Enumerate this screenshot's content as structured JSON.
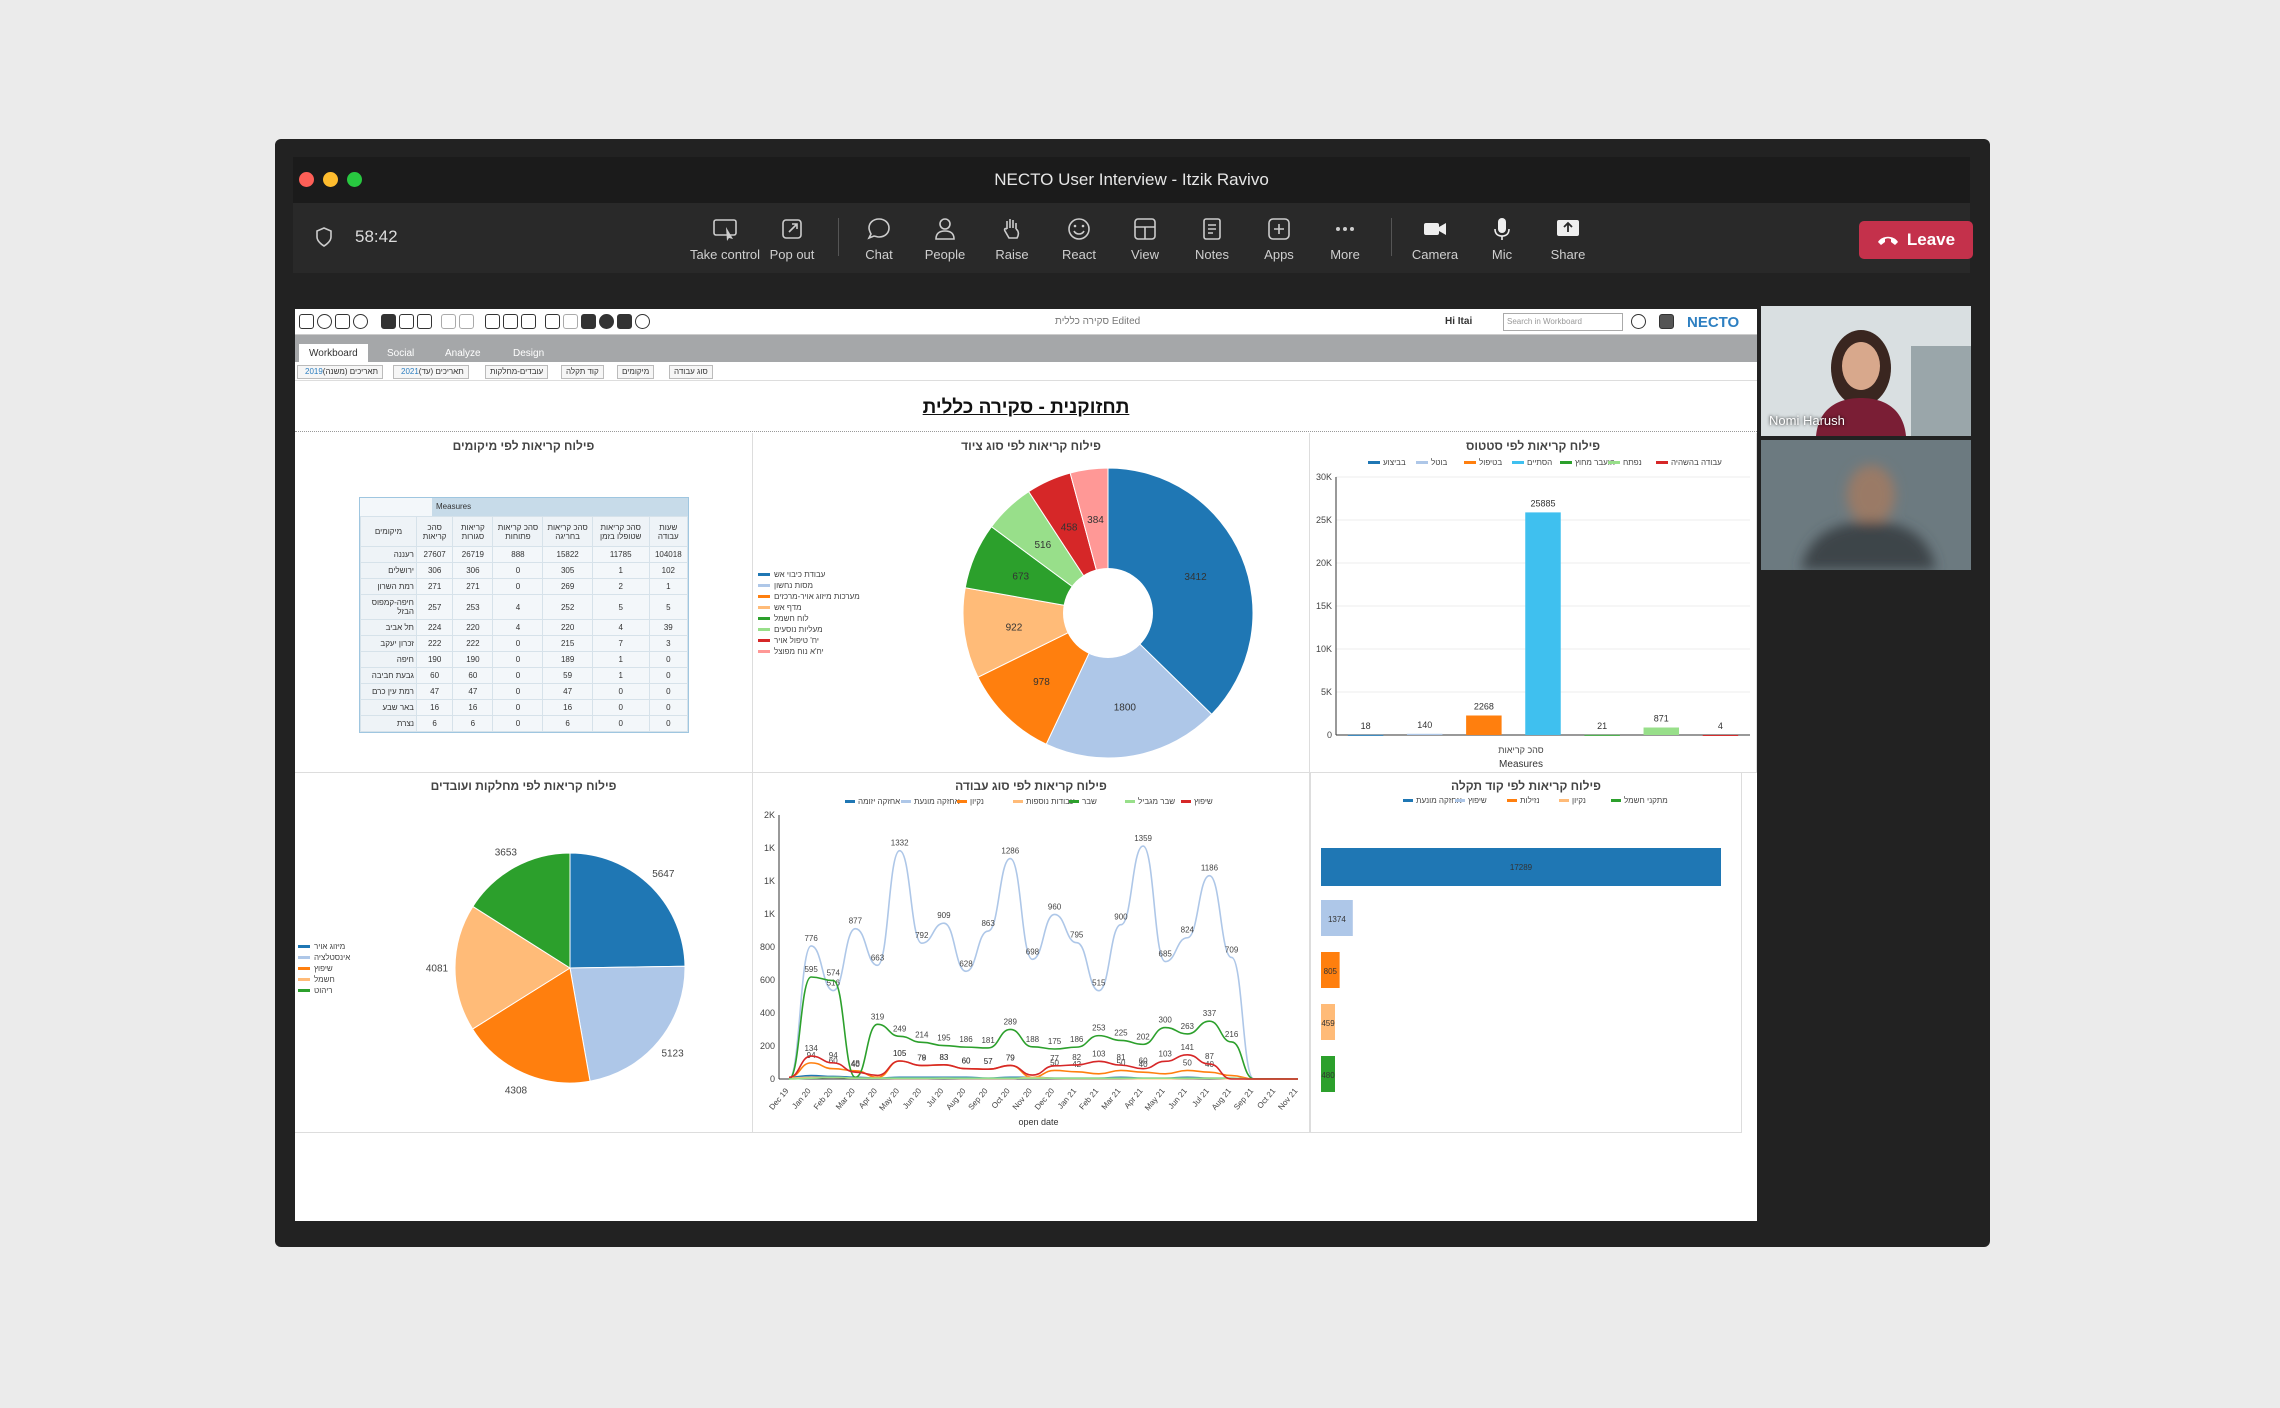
{
  "window": {
    "title": "NECTO User Interview - Itzik Ravivo",
    "timer": "58:42"
  },
  "toolbar": {
    "items": [
      {
        "label": "Take control",
        "icon": "take-control-icon"
      },
      {
        "label": "Pop out",
        "icon": "pop-out-icon"
      },
      {
        "label": "Chat",
        "icon": "chat-icon"
      },
      {
        "label": "People",
        "icon": "people-icon"
      },
      {
        "label": "Raise",
        "icon": "raise-hand-icon"
      },
      {
        "label": "React",
        "icon": "react-icon"
      },
      {
        "label": "View",
        "icon": "view-icon"
      },
      {
        "label": "Notes",
        "icon": "notes-icon"
      },
      {
        "label": "Apps",
        "icon": "apps-icon"
      },
      {
        "label": "More",
        "icon": "more-icon"
      },
      {
        "label": "Camera",
        "icon": "camera-icon"
      },
      {
        "label": "Mic",
        "icon": "mic-icon"
      },
      {
        "label": "Share",
        "icon": "share-icon"
      }
    ],
    "leave": "Leave"
  },
  "participants": [
    {
      "name": "Nomi Harush"
    },
    {
      "name": ""
    }
  ],
  "app": {
    "doc_title": "סקירה כללית Edited",
    "greeting": "Hi Itai",
    "search_placeholder": "Search in Workboard",
    "logo": "NECTO",
    "tabs": [
      "Workboard",
      "Social",
      "Analyze",
      "Design"
    ],
    "filters": [
      {
        "label": "תאריכים (משנה)",
        "value": "2019"
      },
      {
        "label": "תאריכים (עד)",
        "value": "2021"
      },
      {
        "label": "עובדים-מחלקות",
        "value": ""
      },
      {
        "label": "קוד תקלה",
        "value": ""
      },
      {
        "label": "מיקומים",
        "value": ""
      },
      {
        "label": "סוג עבודה",
        "value": ""
      }
    ],
    "dashboard_title": "תחזוקנית - סקירה כללית",
    "colors": {
      "blue": "#1f77b4",
      "lightblue": "#aec7e8",
      "orange": "#ff7f0e",
      "peach": "#ffbb78",
      "green": "#2ca02c",
      "lightgreen": "#98df8a",
      "red": "#d62728",
      "pink": "#ff9896",
      "cyan": "#3fc0ef"
    }
  },
  "location_table": {
    "title": "פילוח קריאות לפי מיקומים",
    "measures_label": "Measures",
    "row_header": "מיקומים",
    "columns": [
      "סהכ קריאות",
      "קריאות סגורות",
      "סהכ קריאות פתוחות",
      "סהכ קריאות בחריגה",
      "סהכ קריאות שטופלו בזמן",
      "שעות עבודה"
    ],
    "rows": [
      {
        "name": "רעננה",
        "values": [
          "27607",
          "26719",
          "888",
          "15822",
          "11785",
          "104018"
        ]
      },
      {
        "name": "ירושלים",
        "values": [
          "306",
          "306",
          "0",
          "305",
          "1",
          "102"
        ]
      },
      {
        "name": "רמת השרון",
        "values": [
          "271",
          "271",
          "0",
          "269",
          "2",
          "1"
        ]
      },
      {
        "name": "חיפה-קמפוס הבזל",
        "values": [
          "257",
          "253",
          "4",
          "252",
          "5",
          "5"
        ]
      },
      {
        "name": "תל אביב",
        "values": [
          "224",
          "220",
          "4",
          "220",
          "4",
          "39"
        ]
      },
      {
        "name": "זכרון יעקב",
        "values": [
          "222",
          "222",
          "0",
          "215",
          "7",
          "3"
        ]
      },
      {
        "name": "חיפה",
        "values": [
          "190",
          "190",
          "0",
          "189",
          "1",
          "0"
        ]
      },
      {
        "name": "גבעת חביבה",
        "values": [
          "60",
          "60",
          "0",
          "59",
          "1",
          "0"
        ]
      },
      {
        "name": "רמת עין כרם",
        "values": [
          "47",
          "47",
          "0",
          "47",
          "0",
          "0"
        ]
      },
      {
        "name": "באר שבע",
        "values": [
          "16",
          "16",
          "0",
          "16",
          "0",
          "0"
        ]
      },
      {
        "name": "נצרת",
        "values": [
          "6",
          "6",
          "0",
          "6",
          "0",
          "0"
        ]
      }
    ]
  },
  "chart_data": [
    {
      "type": "pie",
      "title": "פילוח קריאות לפי סוג ציוד",
      "donut": true,
      "legend_position": "left",
      "slices": [
        {
          "name": "עבודת כיבוי אש",
          "value": 3412,
          "color": "#1f77b4"
        },
        {
          "name": "מסות נחשון",
          "value": 1800,
          "color": "#aec7e8"
        },
        {
          "name": "מערכות מיזוג אויר-מרכזים",
          "value": 978,
          "color": "#ff7f0e"
        },
        {
          "name": "מדף אש",
          "value": 922,
          "color": "#ffbb78"
        },
        {
          "name": "לוח חשמל",
          "value": 673,
          "color": "#2ca02c"
        },
        {
          "name": "מעליות נוסעים",
          "value": 516,
          "color": "#98df8a"
        },
        {
          "name": "יח' טיפול אויר",
          "value": 458,
          "color": "#d62728"
        },
        {
          "name": "יח'א נוח מפוצל",
          "value": 384,
          "color": "#ff9896"
        }
      ]
    },
    {
      "type": "bar",
      "title": "פילוח קריאות לפי סטטוס",
      "xlabel": "Measures",
      "category_label": "סהכ קריאות",
      "ylim": [
        0,
        30000
      ],
      "yticks": [
        "0",
        "5K",
        "10K",
        "15K",
        "20K",
        "25K",
        "30K"
      ],
      "legend_position": "top",
      "series": [
        {
          "name": "בביצוע",
          "value": 18,
          "color": "#1f77b4"
        },
        {
          "name": "בוטל",
          "value": 140,
          "color": "#aec7e8"
        },
        {
          "name": "בטיפול",
          "value": 2268,
          "color": "#ff7f0e"
        },
        {
          "name": "הסתיים",
          "value": 25885,
          "color": "#3fc0ef"
        },
        {
          "name": "הועבר מחוץ",
          "value": 21,
          "color": "#2ca02c"
        },
        {
          "name": "נפתח",
          "value": 871,
          "color": "#98df8a"
        },
        {
          "name": "עבודה בהשהיה",
          "value": 4,
          "color": "#d62728"
        }
      ]
    },
    {
      "type": "pie",
      "title": "פילוח קריאות לפי מחלקות ועובדים",
      "legend_position": "left",
      "slices": [
        {
          "name": "מיזוג אויר",
          "value": 5647,
          "color": "#1f77b4"
        },
        {
          "name": "אינסטלציה",
          "value": 5123,
          "color": "#aec7e8"
        },
        {
          "name": "שיפוץ",
          "value": 4308,
          "color": "#ff7f0e"
        },
        {
          "name": "חשמל",
          "value": 4081,
          "color": "#ffbb78"
        },
        {
          "name": "ריהוט",
          "value": 3653,
          "color": "#2ca02c"
        }
      ]
    },
    {
      "type": "line",
      "title": "פילוח קריאות לפי סוג עבודה",
      "xlabel": "open date",
      "ylim": [
        0,
        1400
      ],
      "yticks": [
        "0",
        "200",
        "400",
        "600",
        "800",
        "1K",
        "1K",
        "1K",
        "2K"
      ],
      "x": [
        "Dec 19",
        "Jan 20",
        "Feb 20",
        "Mar 20",
        "Apr 20",
        "May 20",
        "Jun 20",
        "Jul 20",
        "Aug 20",
        "Sep 20",
        "Oct 20",
        "Nov 20",
        "Dec 20",
        "Jan 21",
        "Feb 21",
        "Mar 21",
        "Apr 21",
        "May 21",
        "Jun 21",
        "Jul 21",
        "Aug 21",
        "Sep 21",
        "Oct 21",
        "Nov 21"
      ],
      "series": [
        {
          "name": "אחזקה יזומה",
          "color": "#1f77b4",
          "values": [
            10,
            20,
            15,
            10,
            5,
            10,
            10,
            10,
            10,
            5,
            10,
            10,
            5,
            5,
            5,
            10,
            5,
            5,
            10,
            5,
            5,
            0,
            0,
            0
          ]
        },
        {
          "name": "אחזקה מונעת",
          "color": "#aec7e8",
          "values": [
            0,
            776,
            516,
            877,
            663,
            1332,
            792,
            909,
            628,
            863,
            1286,
            698,
            960,
            795,
            515,
            900,
            1359,
            685,
            824,
            1186,
            709,
            0,
            0,
            0
          ]
        },
        {
          "name": "נקיון",
          "color": "#ff7f0e",
          "values": [
            10,
            94,
            60,
            48,
            10,
            105,
            78,
            83,
            60,
            57,
            79,
            10,
            50,
            42,
            30,
            50,
            40,
            30,
            50,
            40,
            20,
            0,
            1,
            0
          ]
        },
        {
          "name": "עבודות נוספות",
          "color": "#ffbb78",
          "values": [
            5,
            10,
            10,
            5,
            5,
            3,
            3,
            5,
            3,
            3,
            3,
            10,
            4,
            3,
            3,
            3,
            2,
            2,
            3,
            5,
            2,
            0,
            0,
            0
          ]
        },
        {
          "name": "שבר",
          "color": "#2ca02c",
          "values": [
            0,
            595,
            574,
            10,
            319,
            249,
            214,
            195,
            186,
            181,
            289,
            188,
            175,
            186,
            253,
            225,
            202,
            300,
            263,
            337,
            216,
            1,
            1,
            0
          ]
        },
        {
          "name": "שבר מגביל",
          "color": "#98df8a",
          "values": [
            0,
            5,
            10,
            5,
            5,
            5,
            5,
            5,
            5,
            5,
            5,
            5,
            5,
            5,
            5,
            5,
            5,
            5,
            5,
            5,
            5,
            0,
            0,
            0
          ]
        },
        {
          "name": "שיפוץ",
          "color": "#d62728",
          "values": [
            10,
            134,
            94,
            40,
            21,
            105,
            79,
            83,
            60,
            57,
            79,
            23,
            77,
            82,
            103,
            81,
            60,
            103,
            141,
            87,
            0,
            0,
            0,
            0
          ]
        }
      ]
    },
    {
      "type": "bar",
      "orientation": "horizontal",
      "title": "פילוח קריאות לפי קוד תקלה",
      "legend_position": "top",
      "series": [
        {
          "name": "אחזקה מונעת",
          "value": 17289,
          "color": "#1f77b4"
        },
        {
          "name": "שיפוץ",
          "value": 1374,
          "color": "#aec7e8"
        },
        {
          "name": "נזילות",
          "value": 805,
          "color": "#ff7f0e"
        },
        {
          "name": "נקיון",
          "value": 459,
          "color": "#ffbb78"
        },
        {
          "name": "מתקני חשמל",
          "value": 480,
          "color": "#2ca02c"
        }
      ]
    }
  ]
}
